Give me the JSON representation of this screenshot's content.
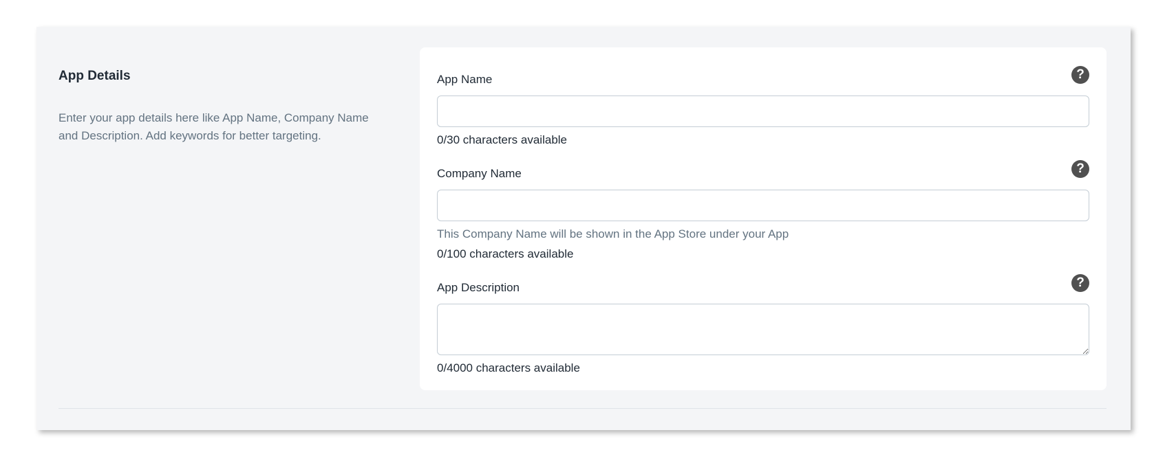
{
  "section": {
    "title": "App Details",
    "description": "Enter your app details here like App Name, Company Name and Description. Add keywords for better targeting."
  },
  "fields": [
    {
      "label": "App Name",
      "value": "",
      "counter": "0/30 characters available",
      "help_icon": "question-icon"
    },
    {
      "label": "Company Name",
      "value": "",
      "help_text": "This Company Name will be shown in the App Store under your App",
      "counter": "0/100 characters available",
      "help_icon": "question-icon"
    },
    {
      "label": "App Description",
      "value": "",
      "counter": "0/4000 characters available",
      "help_icon": "question-icon"
    }
  ],
  "icons": {
    "help_glyph": "?"
  },
  "colors": {
    "panel_background": "#f4f5f7",
    "card_background": "#ffffff",
    "heading_text": "#212b36",
    "muted_text": "#637381",
    "help_icon": "#505050"
  }
}
